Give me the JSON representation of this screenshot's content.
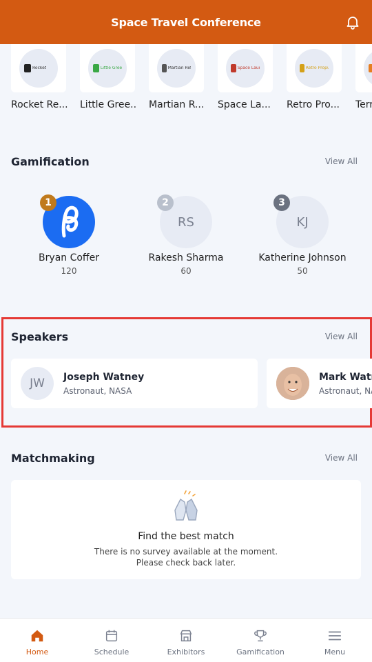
{
  "header": {
    "title": "Space Travel Conference",
    "bell_icon": "bell-icon"
  },
  "sponsors": [
    {
      "name": "Rocket Re...",
      "logo_text": "Rocket",
      "logo_color": "#1a1a1a"
    },
    {
      "name": "Little Gree...",
      "logo_text": "Little Green",
      "logo_color": "#3aa845"
    },
    {
      "name": "Martian R...",
      "logo_text": "Martian Refinery",
      "logo_color": "#555555"
    },
    {
      "name": "Space La...",
      "logo_text": "Space Launch",
      "logo_color": "#c0392b"
    },
    {
      "name": "Retro Pro...",
      "logo_text": "Retro Propulsion",
      "logo_color": "#d4a017"
    },
    {
      "name": "Terr",
      "logo_text": "",
      "logo_color": "#e67e22"
    }
  ],
  "gamification": {
    "title": "Gamification",
    "view_all": "View All",
    "leaders": [
      {
        "rank": "1",
        "name": "Bryan Coffer",
        "score": "120",
        "initials": "",
        "rank_color": "#c07a1c"
      },
      {
        "rank": "2",
        "name": "Rakesh Sharma",
        "score": "60",
        "initials": "RS",
        "rank_color": "#b9c0cc"
      },
      {
        "rank": "3",
        "name": "Katherine Johnson",
        "score": "50",
        "initials": "KJ",
        "rank_color": "#6b7280"
      }
    ]
  },
  "speakers": {
    "title": "Speakers",
    "view_all": "View All",
    "items": [
      {
        "initials": "JW",
        "name": "Joseph Watney",
        "role": "Astronaut, NASA"
      },
      {
        "initials": "",
        "name": "Mark Watney",
        "role": "Astronaut, NASA"
      }
    ]
  },
  "matchmaking": {
    "title": "Matchmaking",
    "view_all": "View All",
    "heading": "Find the best match",
    "line1": "There is no survey available at the moment.",
    "line2": "Please check back later."
  },
  "tabs": [
    {
      "label": "Home",
      "icon": "home-icon",
      "active": true
    },
    {
      "label": "Schedule",
      "icon": "calendar-icon",
      "active": false
    },
    {
      "label": "Exhibitors",
      "icon": "storefront-icon",
      "active": false
    },
    {
      "label": "Gamification",
      "icon": "trophy-icon",
      "active": false
    },
    {
      "label": "Menu",
      "icon": "hamburger-menu-icon",
      "active": false
    }
  ],
  "colors": {
    "brand": "#d35a12",
    "highlight_border": "#e53935"
  }
}
